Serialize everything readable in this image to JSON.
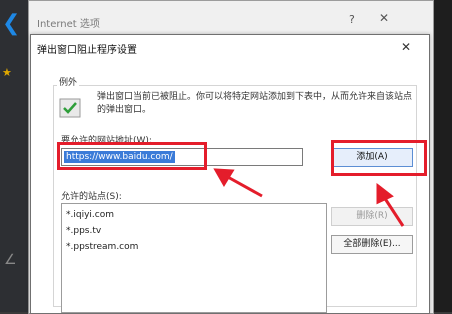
{
  "back_window": {
    "title": "Internet 选项",
    "help_glyph": "?",
    "close_glyph": "✕"
  },
  "browser": {
    "back_glyph": "❮",
    "favorite_glyph": "★",
    "hint_glyph": "∠"
  },
  "dialog": {
    "title": "弹出窗口阻止程序设置",
    "close_glyph": "✕",
    "group_label": "例外",
    "description": "弹出窗口当前已被阻止。你可以将特定网站添加到下表中，从而允许来自该站点的弹出窗口。",
    "address_label": "要允许的网站地址(W):",
    "address_value": "https://www.baidu.com/",
    "add_button": "添加(A)",
    "allowed_label": "允许的站点(S):",
    "allowed_sites": [
      ".iqiyi.com",
      ".pps.tv",
      ".ppstream.com"
    ],
    "site_prefix": "*",
    "delete_button": "删除(R)",
    "delete_all_button": "全部删除(E)..."
  },
  "colors": {
    "highlight": "#e41d2b",
    "selection": "#3b7bd8"
  }
}
